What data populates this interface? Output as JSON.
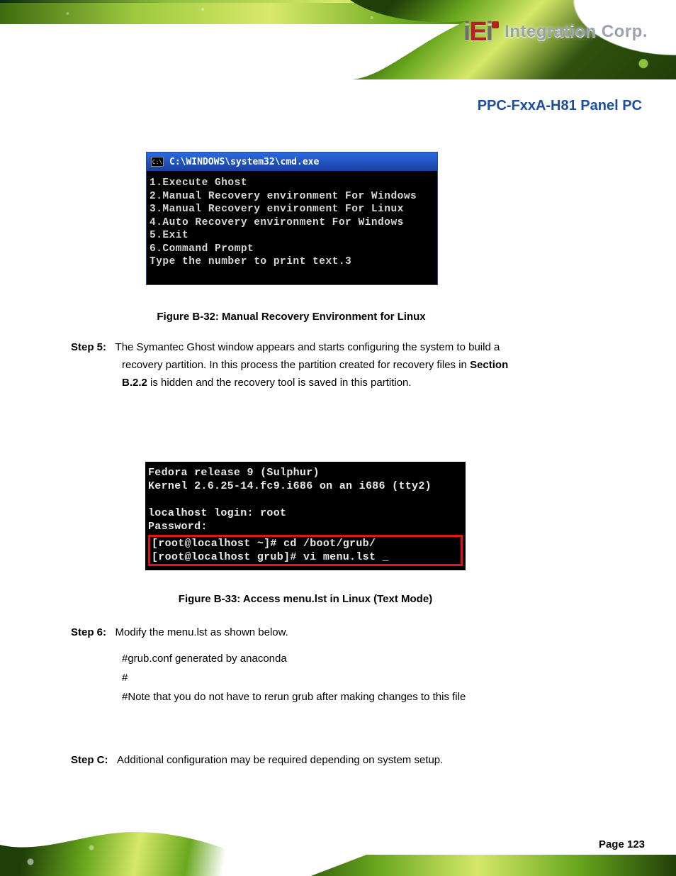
{
  "header": {
    "logo_mark": "iEi",
    "logo_text": "Integration Corp."
  },
  "product_line": "PPC-FxxA-H81 Panel PC",
  "cmd": {
    "title": "C:\\WINDOWS\\system32\\cmd.exe",
    "icon_label": "C:\\",
    "menu": [
      "1.Execute Ghost",
      "2.Manual Recovery environment For Windows",
      "3.Manual Recovery environment For Linux",
      "4.Auto Recovery environment For Windows",
      "5.Exit",
      "6.Command Prompt"
    ],
    "prompt": "Type the number to print text.3"
  },
  "captions": {
    "fig1": "Figure B-32: Manual Recovery Environment for Linux",
    "fig2": "Figure B-33: Access menu.lst in Linux (Text Mode)"
  },
  "step5": {
    "label": "Step 5:",
    "text1": "The Symantec Ghost window appears and starts configuring the system to build a",
    "text2": "recovery partition. In this process the partition created for recovery files in ",
    "sectref": "Section",
    "sectnum": " B.2.2",
    "text3": " is hidden and the recovery tool is saved in this partition."
  },
  "linux": {
    "l1": "Fedora release 9 (Sulphur)",
    "l2": "Kernel 2.6.25-14.fc9.i686 on an i686 (tty2)",
    "l3": "localhost login: root",
    "l4": "Password:",
    "l5": "[root@localhost ~]# cd /boot/grub/",
    "l6": "[root@localhost grub]# vi menu.lst _"
  },
  "step6": {
    "label": "Step 6:",
    "text1": "Modify the menu.lst as shown below.",
    "grub": {
      "g1": "#grub.conf generated by anaconda",
      "g2": "#",
      "g3": "#Note that you do not have to rerun grub after making changes to this file"
    }
  },
  "stepC": {
    "label": "Step C:",
    "text1": "Additional configuration may be required depending on system setup."
  },
  "page_number": "Page 123"
}
